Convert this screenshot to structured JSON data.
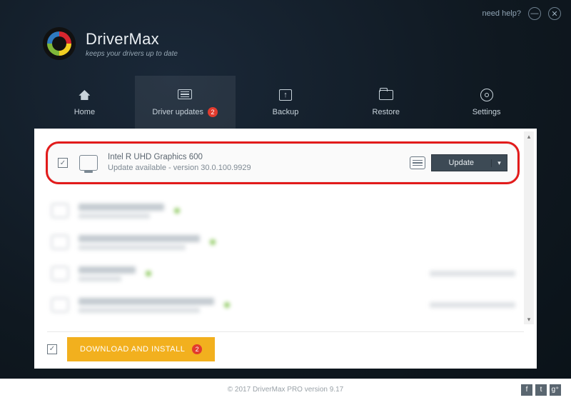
{
  "titlebar": {
    "help": "need help?"
  },
  "brand": {
    "title": "DriverMax",
    "tagline": "keeps your drivers up to date"
  },
  "nav": {
    "home": "Home",
    "updates": "Driver updates",
    "updates_badge": "2",
    "backup": "Backup",
    "restore": "Restore",
    "settings": "Settings"
  },
  "highlighted_driver": {
    "name": "Intel R UHD Graphics 600",
    "status": "Update available - version 30.0.100.9929",
    "action": "Update"
  },
  "blurred_rows": [
    {
      "title_w": 120,
      "right": false
    },
    {
      "title_w": 170,
      "right": false
    },
    {
      "title_w": 80,
      "right": true
    },
    {
      "title_w": 190,
      "right": true
    }
  ],
  "footer": {
    "download": "DOWNLOAD AND INSTALL",
    "badge": "2"
  },
  "bottom": {
    "copyright": "© 2017 DriverMax PRO version 9.17"
  }
}
